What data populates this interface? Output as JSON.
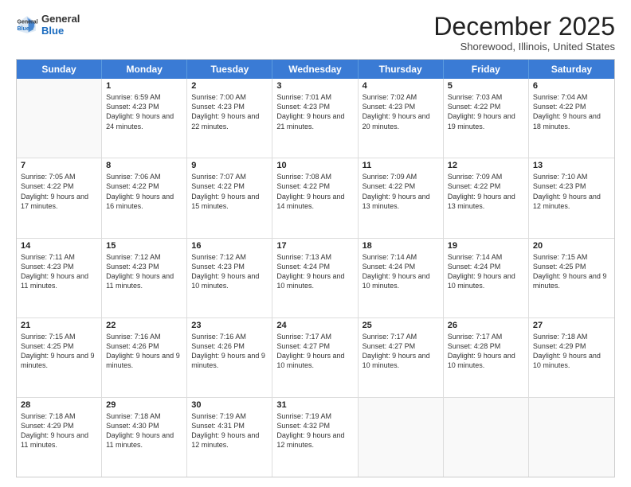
{
  "logo": {
    "general": "General",
    "blue": "Blue"
  },
  "header": {
    "month": "December 2025",
    "location": "Shorewood, Illinois, United States"
  },
  "days": [
    "Sunday",
    "Monday",
    "Tuesday",
    "Wednesday",
    "Thursday",
    "Friday",
    "Saturday"
  ],
  "weeks": [
    [
      {
        "day": "",
        "sunrise": "",
        "sunset": "",
        "daylight": ""
      },
      {
        "day": "1",
        "sunrise": "Sunrise: 6:59 AM",
        "sunset": "Sunset: 4:23 PM",
        "daylight": "Daylight: 9 hours and 24 minutes."
      },
      {
        "day": "2",
        "sunrise": "Sunrise: 7:00 AM",
        "sunset": "Sunset: 4:23 PM",
        "daylight": "Daylight: 9 hours and 22 minutes."
      },
      {
        "day": "3",
        "sunrise": "Sunrise: 7:01 AM",
        "sunset": "Sunset: 4:23 PM",
        "daylight": "Daylight: 9 hours and 21 minutes."
      },
      {
        "day": "4",
        "sunrise": "Sunrise: 7:02 AM",
        "sunset": "Sunset: 4:23 PM",
        "daylight": "Daylight: 9 hours and 20 minutes."
      },
      {
        "day": "5",
        "sunrise": "Sunrise: 7:03 AM",
        "sunset": "Sunset: 4:22 PM",
        "daylight": "Daylight: 9 hours and 19 minutes."
      },
      {
        "day": "6",
        "sunrise": "Sunrise: 7:04 AM",
        "sunset": "Sunset: 4:22 PM",
        "daylight": "Daylight: 9 hours and 18 minutes."
      }
    ],
    [
      {
        "day": "7",
        "sunrise": "Sunrise: 7:05 AM",
        "sunset": "Sunset: 4:22 PM",
        "daylight": "Daylight: 9 hours and 17 minutes."
      },
      {
        "day": "8",
        "sunrise": "Sunrise: 7:06 AM",
        "sunset": "Sunset: 4:22 PM",
        "daylight": "Daylight: 9 hours and 16 minutes."
      },
      {
        "day": "9",
        "sunrise": "Sunrise: 7:07 AM",
        "sunset": "Sunset: 4:22 PM",
        "daylight": "Daylight: 9 hours and 15 minutes."
      },
      {
        "day": "10",
        "sunrise": "Sunrise: 7:08 AM",
        "sunset": "Sunset: 4:22 PM",
        "daylight": "Daylight: 9 hours and 14 minutes."
      },
      {
        "day": "11",
        "sunrise": "Sunrise: 7:09 AM",
        "sunset": "Sunset: 4:22 PM",
        "daylight": "Daylight: 9 hours and 13 minutes."
      },
      {
        "day": "12",
        "sunrise": "Sunrise: 7:09 AM",
        "sunset": "Sunset: 4:22 PM",
        "daylight": "Daylight: 9 hours and 13 minutes."
      },
      {
        "day": "13",
        "sunrise": "Sunrise: 7:10 AM",
        "sunset": "Sunset: 4:23 PM",
        "daylight": "Daylight: 9 hours and 12 minutes."
      }
    ],
    [
      {
        "day": "14",
        "sunrise": "Sunrise: 7:11 AM",
        "sunset": "Sunset: 4:23 PM",
        "daylight": "Daylight: 9 hours and 11 minutes."
      },
      {
        "day": "15",
        "sunrise": "Sunrise: 7:12 AM",
        "sunset": "Sunset: 4:23 PM",
        "daylight": "Daylight: 9 hours and 11 minutes."
      },
      {
        "day": "16",
        "sunrise": "Sunrise: 7:12 AM",
        "sunset": "Sunset: 4:23 PM",
        "daylight": "Daylight: 9 hours and 10 minutes."
      },
      {
        "day": "17",
        "sunrise": "Sunrise: 7:13 AM",
        "sunset": "Sunset: 4:24 PM",
        "daylight": "Daylight: 9 hours and 10 minutes."
      },
      {
        "day": "18",
        "sunrise": "Sunrise: 7:14 AM",
        "sunset": "Sunset: 4:24 PM",
        "daylight": "Daylight: 9 hours and 10 minutes."
      },
      {
        "day": "19",
        "sunrise": "Sunrise: 7:14 AM",
        "sunset": "Sunset: 4:24 PM",
        "daylight": "Daylight: 9 hours and 10 minutes."
      },
      {
        "day": "20",
        "sunrise": "Sunrise: 7:15 AM",
        "sunset": "Sunset: 4:25 PM",
        "daylight": "Daylight: 9 hours and 9 minutes."
      }
    ],
    [
      {
        "day": "21",
        "sunrise": "Sunrise: 7:15 AM",
        "sunset": "Sunset: 4:25 PM",
        "daylight": "Daylight: 9 hours and 9 minutes."
      },
      {
        "day": "22",
        "sunrise": "Sunrise: 7:16 AM",
        "sunset": "Sunset: 4:26 PM",
        "daylight": "Daylight: 9 hours and 9 minutes."
      },
      {
        "day": "23",
        "sunrise": "Sunrise: 7:16 AM",
        "sunset": "Sunset: 4:26 PM",
        "daylight": "Daylight: 9 hours and 9 minutes."
      },
      {
        "day": "24",
        "sunrise": "Sunrise: 7:17 AM",
        "sunset": "Sunset: 4:27 PM",
        "daylight": "Daylight: 9 hours and 10 minutes."
      },
      {
        "day": "25",
        "sunrise": "Sunrise: 7:17 AM",
        "sunset": "Sunset: 4:27 PM",
        "daylight": "Daylight: 9 hours and 10 minutes."
      },
      {
        "day": "26",
        "sunrise": "Sunrise: 7:17 AM",
        "sunset": "Sunset: 4:28 PM",
        "daylight": "Daylight: 9 hours and 10 minutes."
      },
      {
        "day": "27",
        "sunrise": "Sunrise: 7:18 AM",
        "sunset": "Sunset: 4:29 PM",
        "daylight": "Daylight: 9 hours and 10 minutes."
      }
    ],
    [
      {
        "day": "28",
        "sunrise": "Sunrise: 7:18 AM",
        "sunset": "Sunset: 4:29 PM",
        "daylight": "Daylight: 9 hours and 11 minutes."
      },
      {
        "day": "29",
        "sunrise": "Sunrise: 7:18 AM",
        "sunset": "Sunset: 4:30 PM",
        "daylight": "Daylight: 9 hours and 11 minutes."
      },
      {
        "day": "30",
        "sunrise": "Sunrise: 7:19 AM",
        "sunset": "Sunset: 4:31 PM",
        "daylight": "Daylight: 9 hours and 12 minutes."
      },
      {
        "day": "31",
        "sunrise": "Sunrise: 7:19 AM",
        "sunset": "Sunset: 4:32 PM",
        "daylight": "Daylight: 9 hours and 12 minutes."
      },
      {
        "day": "",
        "sunrise": "",
        "sunset": "",
        "daylight": ""
      },
      {
        "day": "",
        "sunrise": "",
        "sunset": "",
        "daylight": ""
      },
      {
        "day": "",
        "sunrise": "",
        "sunset": "",
        "daylight": ""
      }
    ]
  ]
}
